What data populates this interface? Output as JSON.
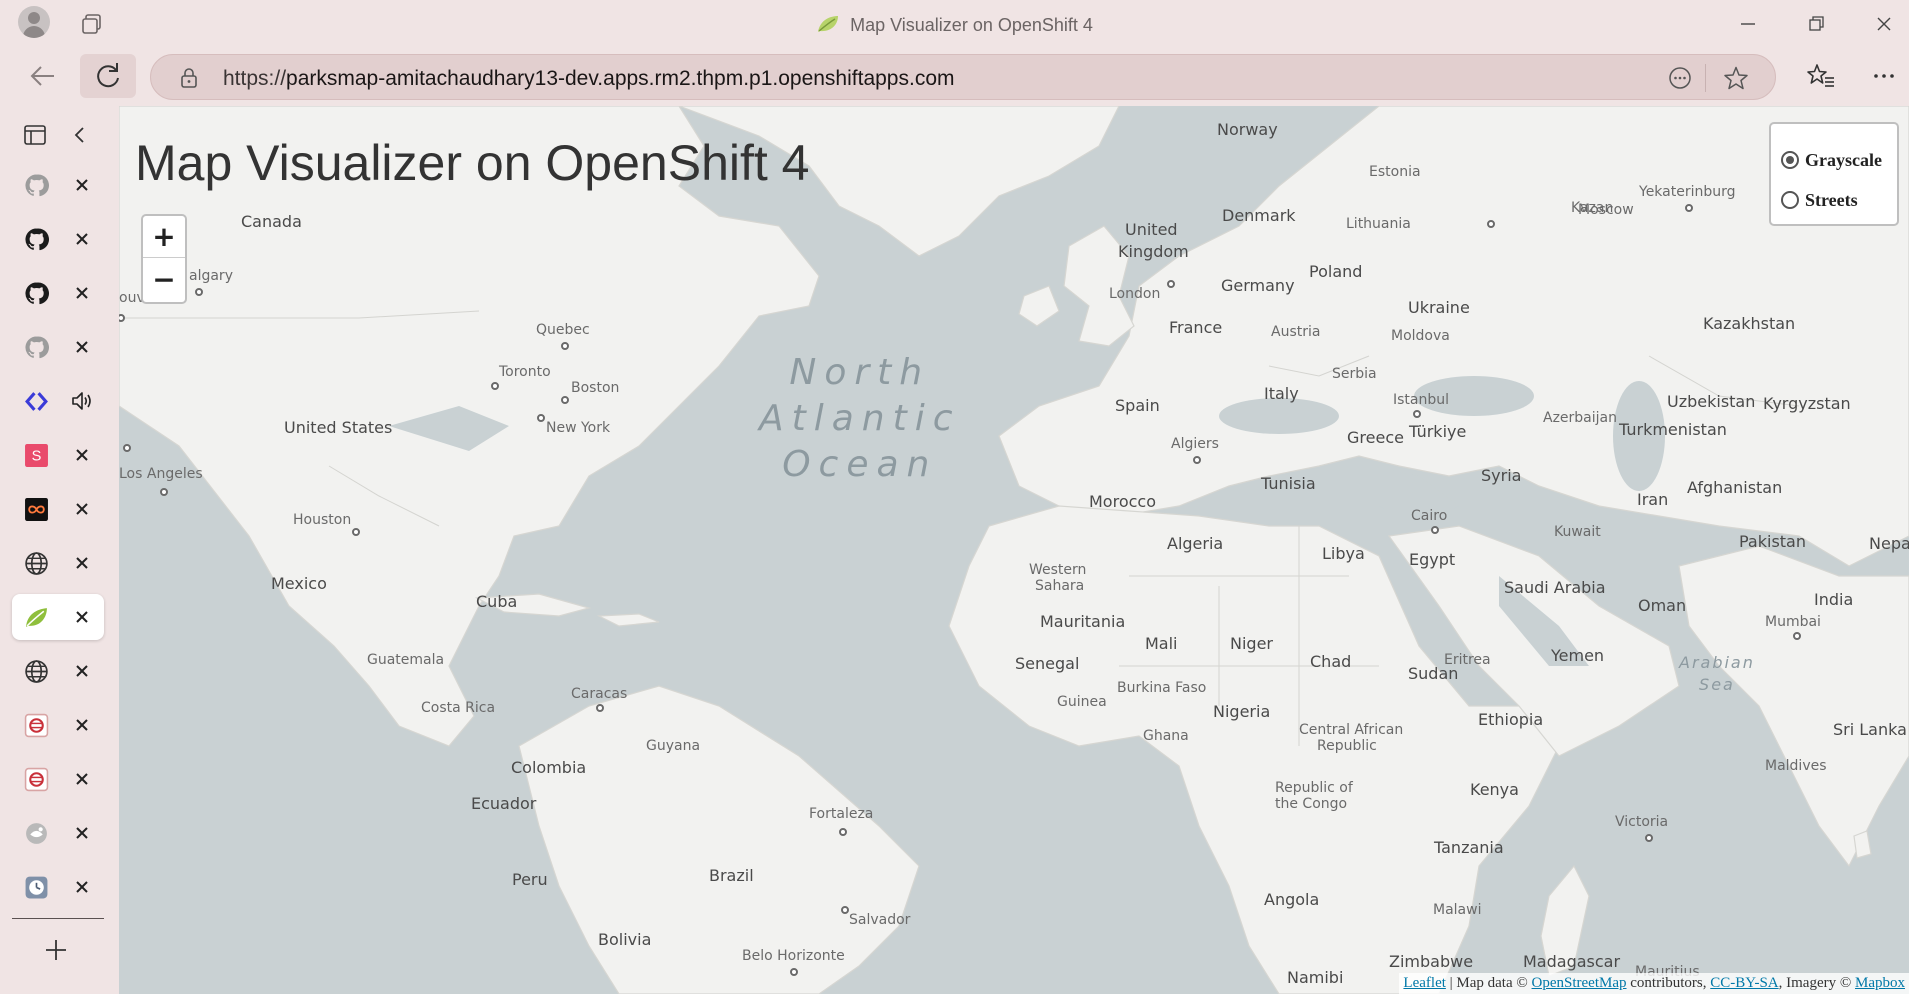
{
  "window": {
    "title": "Map Visualizer on OpenShift 4"
  },
  "toolbar": {
    "url_scheme": "https://",
    "url_host": "parksmap-amitachaudhary13-dev.apps.rm2.thpm.p1.openshiftapps.com"
  },
  "vertical_tabs": [
    {
      "favicon": "github-icon-gray",
      "active": false
    },
    {
      "favicon": "github-icon",
      "active": false
    },
    {
      "favicon": "github-icon",
      "active": false
    },
    {
      "favicon": "github-icon-gray",
      "active": false
    },
    {
      "favicon": "code-brackets-icon",
      "active": false,
      "audio": true
    },
    {
      "favicon": "s-logo-icon",
      "s_letter": "S",
      "active": false
    },
    {
      "favicon": "infinity-icon",
      "active": false
    },
    {
      "favicon": "globe-icon",
      "active": false
    },
    {
      "favicon": "leaf-icon",
      "active": true
    },
    {
      "favicon": "globe-icon",
      "active": false
    },
    {
      "favicon": "openshift-icon",
      "active": false
    },
    {
      "favicon": "openshift-icon",
      "active": false
    },
    {
      "favicon": "gray-logo-icon",
      "active": false
    },
    {
      "favicon": "clock-icon",
      "active": false
    }
  ],
  "page": {
    "title": "Map Visualizer on OpenShift 4",
    "zoom_in": "+",
    "zoom_out": "−",
    "layers": [
      {
        "label": "Grayscale",
        "selected": true
      },
      {
        "label": "Streets",
        "selected": false
      }
    ],
    "attribution": {
      "leaflet": "Leaflet",
      "sep": " | Map data © ",
      "osm": "OpenStreetMap",
      "contrib": " contributors, ",
      "license": "CC-BY-SA",
      "imagery": ", Imagery © ",
      "mapbox": "Mapbox"
    }
  },
  "map_labels": {
    "ocean_line1": "North",
    "ocean_line2": "Atlantic",
    "ocean_line3": "Ocean",
    "arabian_sea_1": "Arabian",
    "arabian_sea_2": "Sea",
    "canada": "Canada",
    "calgary": "algary",
    "vancouver": "ouv",
    "united_states": "United States",
    "los_angeles": "Los Angeles",
    "houston": "Houston",
    "mexico": "Mexico",
    "quebec": "Quebec",
    "toronto": "Toronto",
    "boston": "Boston",
    "new_york": "New York",
    "cuba": "Cuba",
    "guatemala": "Guatemala",
    "costa_rica": "Costa Rica",
    "caracas": "Caracas",
    "guyana": "Guyana",
    "colombia": "Colombia",
    "ecuador": "Ecuador",
    "peru": "Peru",
    "brazil": "Brazil",
    "bolivia": "Bolivia",
    "fortaleza": "Fortaleza",
    "salvador": "Salvador",
    "belo_horizonte": "Belo Horizonte",
    "norway": "Norway",
    "estonia": "Estonia",
    "denmark": "Denmark",
    "lithuania": "Lithuania",
    "united_kingdom_1": "United",
    "united_kingdom_2": "Kingdom",
    "london": "London",
    "germany": "Germany",
    "poland": "Poland",
    "france": "France",
    "austria": "Austria",
    "ukraine": "Ukraine",
    "moldova": "Moldova",
    "spain": "Spain",
    "italy": "Italy",
    "serbia": "Serbia",
    "istanbul": "Istanbul",
    "greece": "Greece",
    "turkiye": "Türkiye",
    "algiers": "Algiers",
    "tunisia": "Tunisia",
    "morocco": "Morocco",
    "algeria": "Algeria",
    "libya": "Libya",
    "egypt": "Egypt",
    "cairo": "Cairo",
    "syria": "Syria",
    "western_sahara_1": "Western",
    "western_sahara_2": "Sahara",
    "mauritania": "Mauritania",
    "mali": "Mali",
    "niger": "Niger",
    "chad": "Chad",
    "sudan": "Sudan",
    "senegal": "Senegal",
    "guinea": "Guinea",
    "burkina_faso": "Burkina Faso",
    "ghana": "Ghana",
    "nigeria": "Nigeria",
    "car_1": "Central African",
    "car_2": "Republic",
    "eritrea": "Eritrea",
    "ethiopia": "Ethiopia",
    "roc_1": "Republic of",
    "roc_2": "the Congo",
    "kenya": "Kenya",
    "tanzania": "Tanzania",
    "malawi": "Malawi",
    "angola": "Angola",
    "zimbabwe": "Zimbabwe",
    "namibia": "Namibi",
    "madagascar": "Madagascar",
    "mauritius": "Mauritius",
    "moscow": "Moscow",
    "kazan": "Kazan",
    "yekaterinburg": "Yekaterinburg",
    "kazakhstan": "Kazakhstan",
    "uzbekistan": "Uzbekistan",
    "kyrgyzstan": "Kyrgyzstan",
    "azerbaijan": "Azerbaijan",
    "turkmenistan": "Turkmenistan",
    "iran": "Iran",
    "afghanistan": "Afghanistan",
    "pakistan": "Pakistan",
    "nepal": "Nepa",
    "kuwait": "Kuwait",
    "saudi_arabia": "Saudi Arabia",
    "oman": "Oman",
    "yemen": "Yemen",
    "india": "India",
    "mumbai": "Mumbai",
    "sri_lanka": "Sri Lanka",
    "maldives": "Maldives",
    "victoria": "Victoria"
  },
  "colors": {
    "water": "#c9d1d3",
    "land": "#f2f2f0",
    "chrome": "#f0e4e4",
    "link": "#0078a8"
  }
}
